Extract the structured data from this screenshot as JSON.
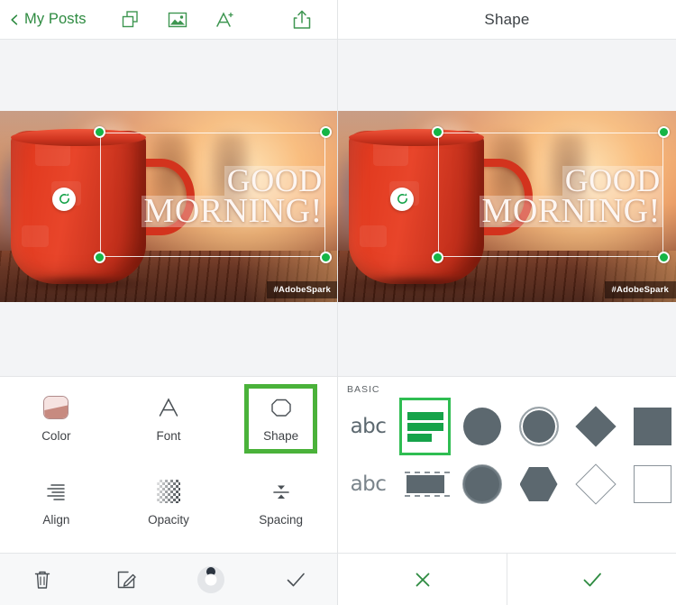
{
  "left_pane": {
    "header": {
      "back_label": "My Posts",
      "back_icon": "chevron-left-icon",
      "icons": [
        "duplicate-layers-icon",
        "image-icon",
        "add-text-icon"
      ],
      "share_icon": "share-icon",
      "accent_color": "#2e8b41"
    },
    "poster": {
      "text_lines": [
        "GOOD",
        "MORNING!"
      ],
      "watermark": "#AdobeSpark",
      "rotate_handle_icon": "rotate-icon",
      "handle_color": "#15b546",
      "selection_handles": [
        "top-left",
        "top-right",
        "bottom-left",
        "bottom-right"
      ]
    },
    "tools": [
      {
        "label": "Color",
        "icon": "color-swatch-icon",
        "selected": false
      },
      {
        "label": "Font",
        "icon": "font-a-icon",
        "selected": false
      },
      {
        "label": "Shape",
        "icon": "octagon-icon",
        "selected": true
      },
      {
        "label": "Align",
        "icon": "align-right-icon",
        "selected": false
      },
      {
        "label": "Opacity",
        "icon": "checkerboard-icon",
        "selected": false
      },
      {
        "label": "Spacing",
        "icon": "line-spacing-icon",
        "selected": false
      }
    ],
    "bottom_bar": [
      {
        "icon": "trash-icon"
      },
      {
        "icon": "edit-pencil-icon"
      },
      {
        "icon": "opacity-dial-icon"
      },
      {
        "icon": "checkmark-icon"
      }
    ],
    "selection_color": "#4ab23a"
  },
  "right_pane": {
    "header": {
      "title": "Shape"
    },
    "poster": {
      "text_lines": [
        "GOOD",
        "MORNING!"
      ],
      "watermark": "#AdobeSpark"
    },
    "shape_picker": {
      "section_label": "BASIC",
      "selected_index": 1,
      "selected_color": "#2fbd52",
      "shape_color": "#5c686f",
      "row1": [
        {
          "name": "no-shape",
          "icon": "abc-plain-icon"
        },
        {
          "name": "text-highlight-bars",
          "icon": "green-bars-icon"
        },
        {
          "name": "filled-circle",
          "icon": "circle-icon"
        },
        {
          "name": "ringed-circle",
          "icon": "circle-ring-icon"
        },
        {
          "name": "filled-diamond",
          "icon": "diamond-icon"
        },
        {
          "name": "filled-square",
          "icon": "square-icon"
        }
      ],
      "row2": [
        {
          "name": "abc-outline",
          "icon": "abc-outline-icon"
        },
        {
          "name": "dashed-bar",
          "icon": "dashed-bar-icon"
        },
        {
          "name": "circle-solid",
          "icon": "circle-solid-icon"
        },
        {
          "name": "hexagon",
          "icon": "hexagon-icon"
        },
        {
          "name": "outline-diamond",
          "icon": "diamond-outline-icon"
        },
        {
          "name": "outline-square",
          "icon": "square-outline-icon"
        }
      ]
    },
    "bottom_bar": {
      "cancel_icon": "close-x-icon",
      "confirm_icon": "checkmark-icon",
      "accent_color": "#2e8b41"
    }
  }
}
